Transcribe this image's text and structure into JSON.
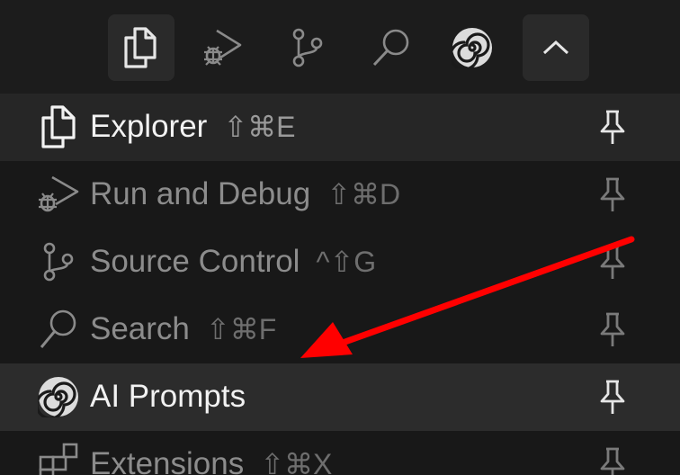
{
  "tabs": [
    {
      "name": "explorer-tab",
      "icon": "files-icon"
    },
    {
      "name": "run-debug-tab",
      "icon": "debug-alt-icon"
    },
    {
      "name": "source-control-tab",
      "icon": "git-branch-icon"
    },
    {
      "name": "search-tab",
      "icon": "search-icon"
    },
    {
      "name": "ai-prompts-tab",
      "icon": "spiral-icon"
    },
    {
      "name": "collapse-tab",
      "icon": "chevron-up-icon"
    }
  ],
  "menu": {
    "items": [
      {
        "label": "Explorer",
        "shortcut": "⇧⌘E",
        "icon": "files-icon",
        "pin_icon": "pin-icon"
      },
      {
        "label": "Run and Debug",
        "shortcut": "⇧⌘D",
        "icon": "debug-alt-icon",
        "pin_icon": "pin-icon"
      },
      {
        "label": "Source Control",
        "shortcut": "^⇧G",
        "icon": "git-branch-icon",
        "pin_icon": "pin-icon"
      },
      {
        "label": "Search",
        "shortcut": "⇧⌘F",
        "icon": "search-icon",
        "pin_icon": "pin-icon"
      },
      {
        "label": "AI Prompts",
        "shortcut": "",
        "icon": "spiral-icon",
        "pin_icon": "pin-icon"
      },
      {
        "label": "Extensions",
        "shortcut": "⇧⌘X",
        "icon": "extensions-icon",
        "pin_icon": "pin-icon"
      }
    ]
  },
  "annotation": {
    "type": "red-arrow",
    "color": "#ff0000",
    "target": "AI Prompts"
  },
  "colors": {
    "background": "#181818",
    "text_active": "#f2f2f2",
    "text_dim": "#8c8c8c",
    "arrow": "#ff0000"
  }
}
